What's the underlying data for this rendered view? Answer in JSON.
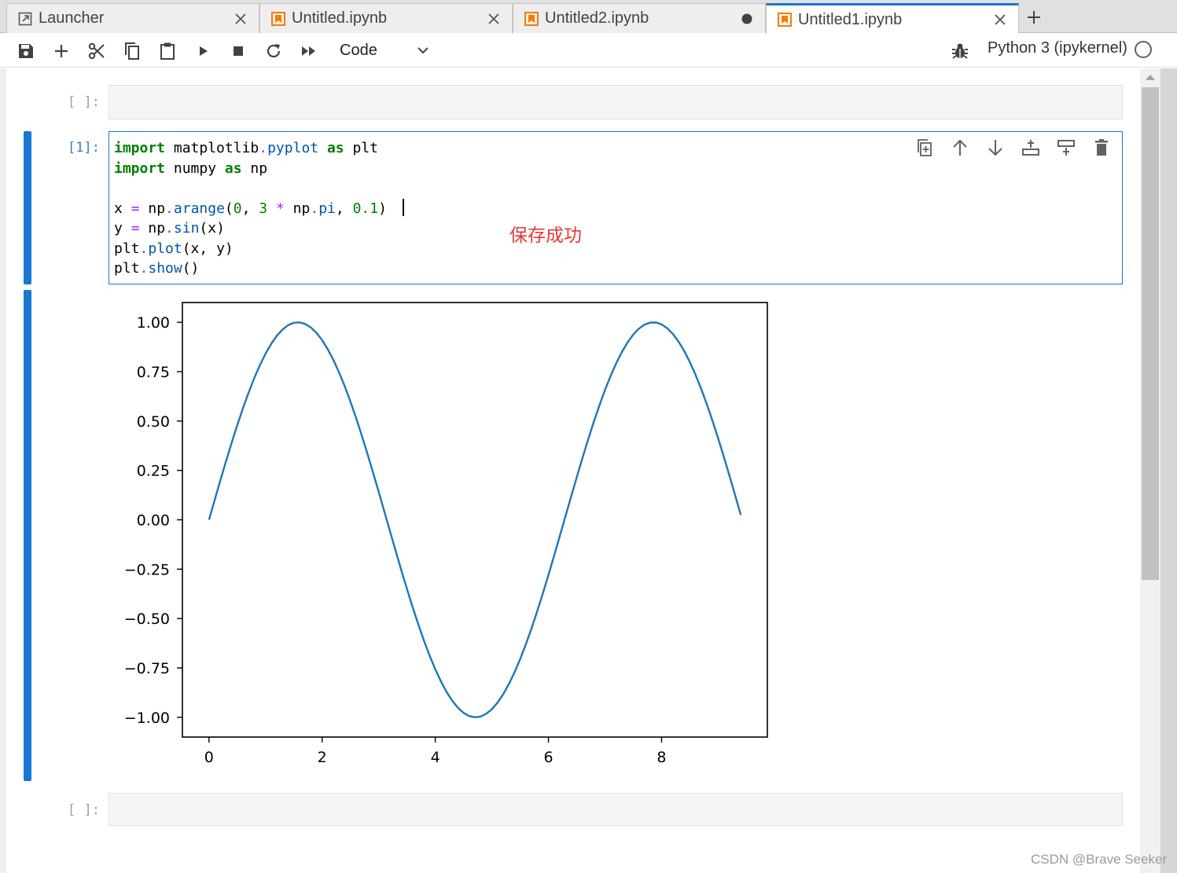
{
  "tabs": [
    {
      "label": "Launcher",
      "icon": "launcher-icon",
      "control": "close"
    },
    {
      "label": "Untitled.ipynb",
      "icon": "notebook-icon",
      "control": "close"
    },
    {
      "label": "Untitled2.ipynb",
      "icon": "notebook-icon",
      "control": "unsaved-dot"
    },
    {
      "label": "Untitled1.ipynb",
      "icon": "notebook-icon",
      "control": "close",
      "active": true
    }
  ],
  "toolbar": {
    "cell_type": "Code",
    "kernel_name": "Python 3 (ipykernel)",
    "buttons": [
      "save-icon",
      "add-icon",
      "cut-icon",
      "copy-icon",
      "paste-icon",
      "run-icon",
      "stop-icon",
      "restart-icon",
      "fast-forward-icon"
    ]
  },
  "cells": {
    "top_prompt": "[ ]:",
    "active_prompt": "[1]:",
    "bottom_prompt": "[ ]:",
    "code_lines": [
      "import matplotlib.pyplot as plt",
      "import numpy as np",
      "",
      "x = np.arange(0, 3 * np.pi, 0.1)",
      "y = np.sin(x)",
      "plt.plot(x, y)",
      "plt.show()"
    ],
    "tools": [
      "duplicate-icon",
      "move-up-icon",
      "move-down-icon",
      "insert-above-icon",
      "insert-below-icon",
      "delete-icon"
    ]
  },
  "save_message": "保存成功",
  "watermark": "CSDN @Brave Seeker",
  "colors": {
    "accent": "#1976d2",
    "line": "#1f77b4",
    "notebook_icon": "#f57c00",
    "save_message": "#e53935"
  },
  "chart_data": {
    "type": "line",
    "title": "",
    "xlabel": "",
    "ylabel": "",
    "function": "y = sin(x)",
    "x_start": 0,
    "x_end": 9.4,
    "x_step": 0.1,
    "xlim": [
      -0.47,
      9.87
    ],
    "ylim": [
      -1.1,
      1.1
    ],
    "xticks": [
      0,
      2,
      4,
      6,
      8
    ],
    "yticks": [
      1.0,
      0.75,
      0.5,
      0.25,
      0.0,
      -0.25,
      -0.5,
      -0.75,
      -1.0
    ],
    "xtick_labels": [
      "0",
      "2",
      "4",
      "6",
      "8"
    ],
    "ytick_labels": [
      "1.00",
      "0.75",
      "0.50",
      "0.25",
      "0.00",
      "−0.25",
      "−0.50",
      "−0.75",
      "−1.00"
    ],
    "grid": false,
    "legend": "none"
  }
}
